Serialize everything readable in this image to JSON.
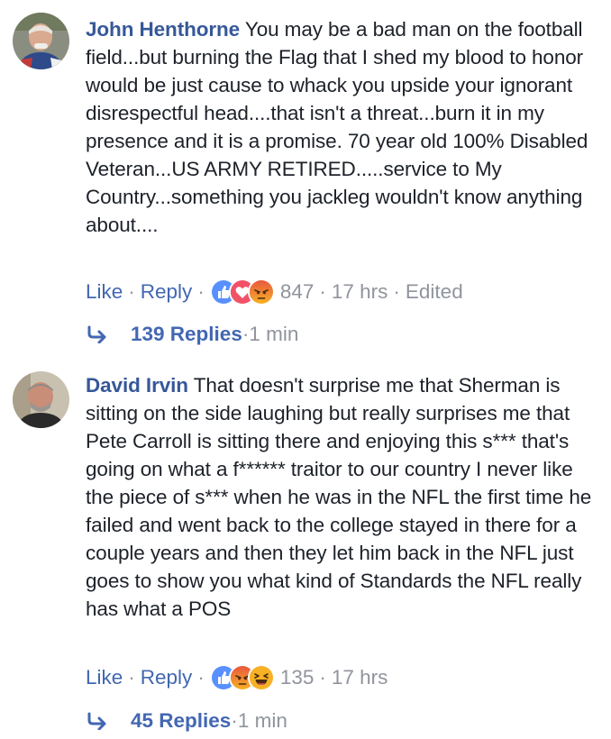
{
  "comments": [
    {
      "author": "John Henthorne",
      "text": "You may be a bad man on the football field...but burning the Flag that I shed my blood to honor would be just cause to whack you upside your ignorant disrespectful head....that isn't a threat...burn it in my presence and it is a promise. 70 year old 100% Disabled Veteran...US ARMY RETIRED.....service to My Country...something you jackleg wouldn't know anything about....",
      "like_label": "Like",
      "reply_label": "Reply",
      "reactions": [
        "like",
        "love",
        "angry"
      ],
      "reaction_count": "847",
      "time": "17 hrs",
      "edited": "Edited",
      "replies_label": "139 Replies",
      "replies_time": "1 min"
    },
    {
      "author": "David Irvin",
      "text": "That doesn't surprise me that Sherman is sitting on the side laughing but really surprises me that Pete Carroll is sitting there and enjoying this s*** that's going on what a f****** traitor to our country I never like the piece of s*** when he was in the NFL the first time he failed and went back to the college stayed in there for a couple years and then they let him back in the NFL just goes to show you what kind of Standards the NFL really has what a POS",
      "like_label": "Like",
      "reply_label": "Reply",
      "reactions": [
        "like",
        "angry",
        "haha"
      ],
      "reaction_count": "135",
      "time": "17 hrs",
      "replies_label": "45 Replies",
      "replies_time": "1 min"
    }
  ],
  "separator": "·",
  "colors": {
    "author": "#365899",
    "link": "#4267b2",
    "meta": "#90949c",
    "text": "#1d2129",
    "like": "#5890ff",
    "love": "#f25268",
    "angry": "#f0613b",
    "haha": "#f7b125"
  }
}
